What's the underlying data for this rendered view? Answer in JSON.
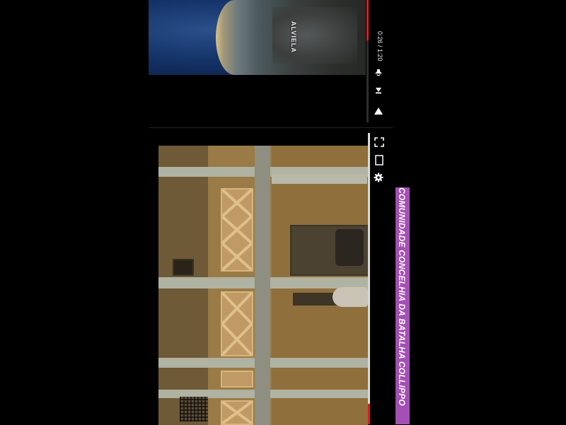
{
  "video1": {
    "place_label": "ALVIELA",
    "time_current": "0:26",
    "time_separator": " / ",
    "time_total": "1:20",
    "progress_fraction": 0.33,
    "icons": {
      "play": "play-icon",
      "next": "next-icon",
      "volume": "volume-icon"
    },
    "colors": {
      "progress": "#e21b1b",
      "background": "#000000"
    }
  },
  "video2": {
    "progress_fraction": 0.07,
    "icons": {
      "fullscreen": "fullscreen-icon",
      "theater": "theater-mode-icon",
      "settings": "settings-gear-icon"
    }
  },
  "caption": {
    "text": "COMUNIDADE CONCELHIA DA BATALHA COLLIPPO",
    "background": "#a44fb4"
  }
}
